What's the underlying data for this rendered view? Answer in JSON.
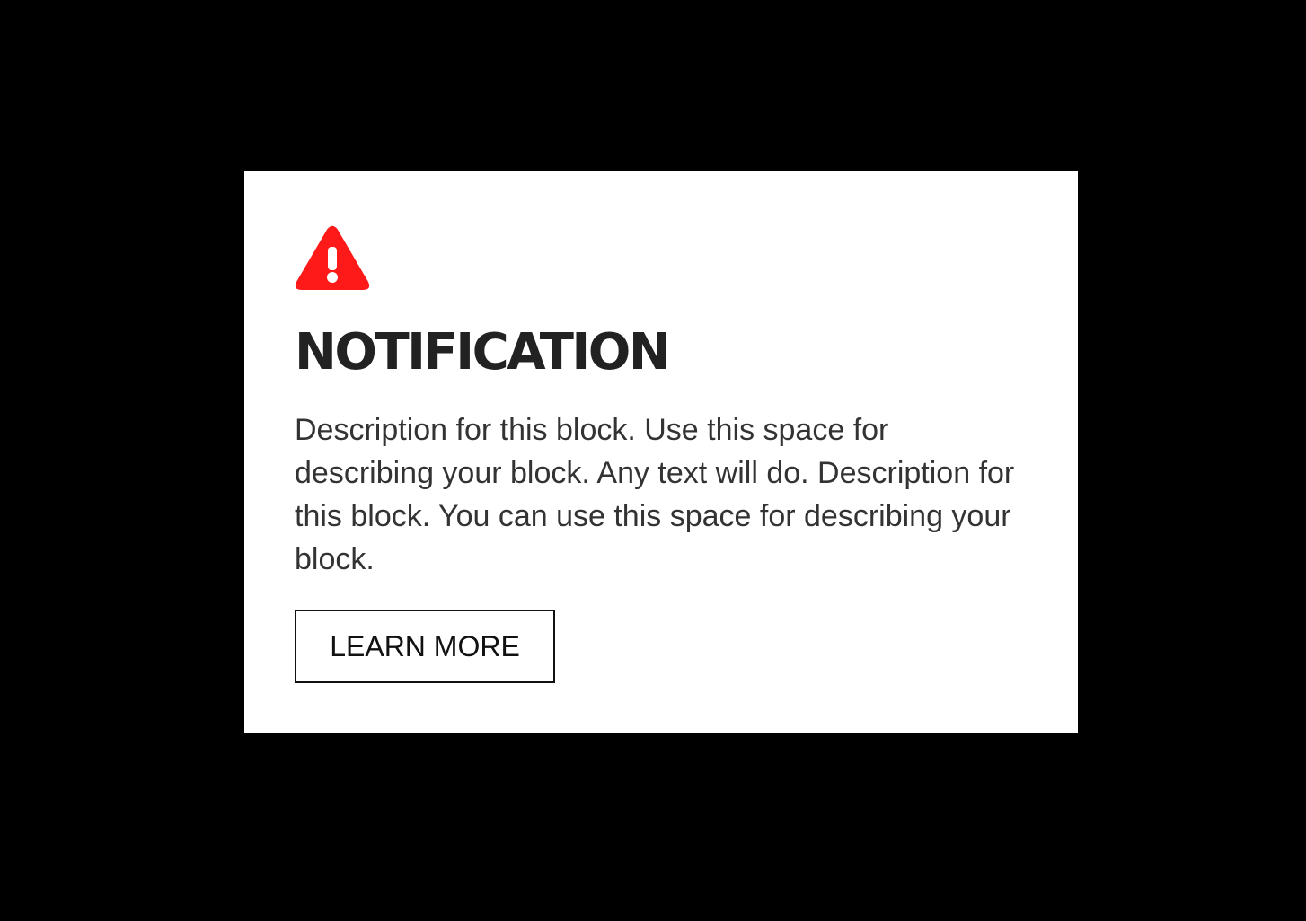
{
  "notification": {
    "icon": "warning-triangle-icon",
    "accent_color": "#ff1a1a",
    "title": "NOTIFICATION",
    "description": "Description for this block. Use this space for describing your block. Any text will do. Description for this block. You can use this space for describing your block.",
    "button_label": "LEARN MORE"
  }
}
